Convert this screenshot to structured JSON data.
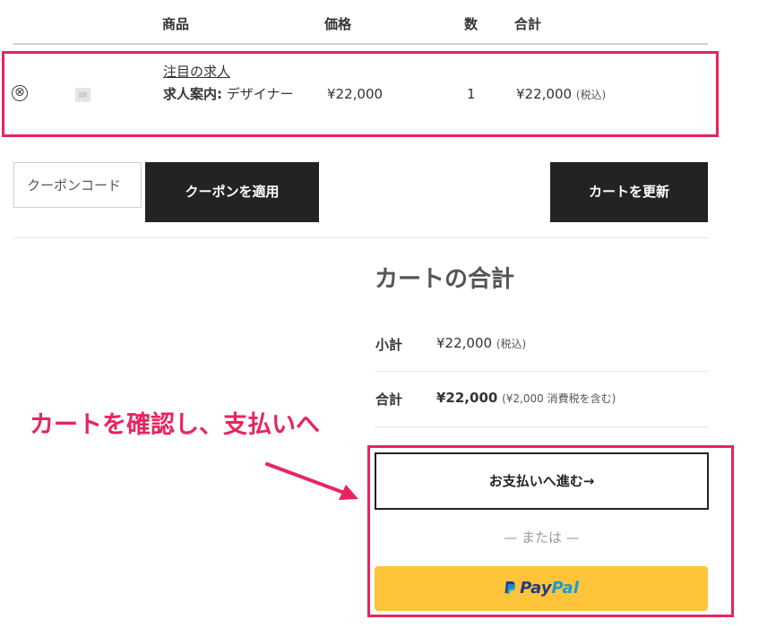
{
  "table_header": {
    "product": "商品",
    "price": "価格",
    "qty": "数",
    "total": "合計"
  },
  "cart_item": {
    "remove_symbol": "⊗",
    "name": "注目の求人",
    "meta_label": "求人案内:",
    "meta_value": "デザイナー",
    "price": "¥22,000",
    "qty": "1",
    "subtotal": "¥22,000",
    "subtotal_tax_note": "(税込)"
  },
  "coupon": {
    "placeholder": "クーポンコード",
    "apply_label": "クーポンを適用"
  },
  "update_cart_label": "カートを更新",
  "cart_totals": {
    "title": "カートの合計",
    "subtotal_label": "小計",
    "subtotal_value": "¥22,000",
    "subtotal_tax_note": "(税込)",
    "total_label": "合計",
    "total_value": "¥22,000",
    "total_tax_note": "(¥2,000 消費税を含む)"
  },
  "checkout_button": "お支払いへ進む→",
  "or_text": "— または —",
  "paypal": {
    "pay": "Pay",
    "pal": "Pal"
  },
  "annotation": "カートを確認し、支払いへ",
  "colors": {
    "highlight": "#e8245e",
    "dark_button": "#232323",
    "paypal_yellow": "#ffc439",
    "paypal_dark_blue": "#253b80",
    "paypal_light_blue": "#179bd7"
  }
}
